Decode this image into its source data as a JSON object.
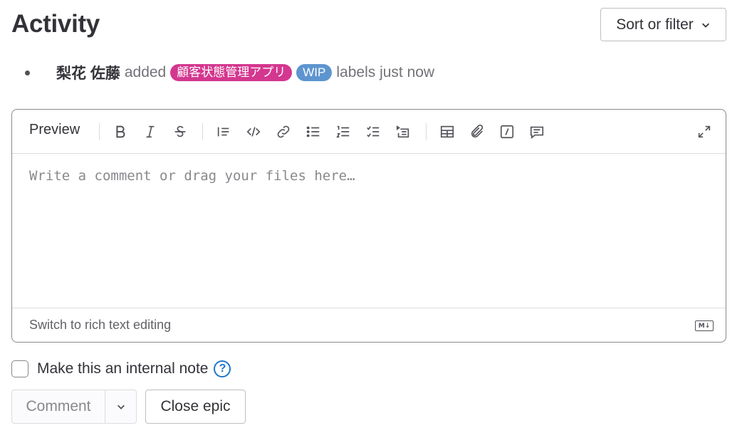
{
  "header": {
    "title": "Activity",
    "sort_filter_label": "Sort or filter"
  },
  "activity": {
    "author": "梨花 佐藤",
    "action": "added",
    "labels": [
      {
        "text": "顧客状態管理アプリ",
        "color": "#d4378f"
      },
      {
        "text": "WIP",
        "color": "#5e95cf"
      }
    ],
    "suffix": "labels just now"
  },
  "editor": {
    "preview_tab": "Preview",
    "toolbar_icons": [
      "bold-icon",
      "italic-icon",
      "strikethrough-icon",
      "quote-icon",
      "code-icon",
      "link-icon",
      "bulleted-list-icon",
      "numbered-list-icon",
      "task-list-icon",
      "collapsible-section-icon",
      "table-icon",
      "attach-file-icon",
      "quick-actions-icon",
      "comment-template-icon",
      "fullscreen-icon"
    ],
    "placeholder": "Write a comment or drag your files here…",
    "switch_label": "Switch to rich text editing",
    "markdown_icon_text": "M↓"
  },
  "internal_note": {
    "label": "Make this an internal note",
    "help_icon": "?"
  },
  "actions": {
    "comment_label": "Comment",
    "close_label": "Close epic"
  }
}
